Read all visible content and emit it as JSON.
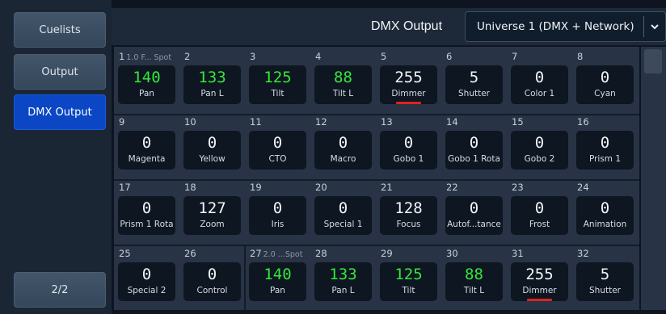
{
  "sidebar": {
    "cuelists": "Cuelists",
    "output": "Output",
    "dmx_output": "DMX Output",
    "page": "2/2"
  },
  "header": {
    "title": "DMX Output",
    "universe": "Universe 1 (DMX + Network)",
    "dropdown_icon": "chevron-down"
  },
  "colors": {
    "active": "#0b47c4",
    "changed_value": "#36e63b",
    "dimmer_marker": "#e0221f"
  },
  "channels": [
    {
      "ch": "1",
      "fixture": "1.0 F... Spot",
      "value": "140",
      "name": "Pan",
      "green": true
    },
    {
      "ch": "2",
      "value": "133",
      "name": "Pan L",
      "green": true
    },
    {
      "ch": "3",
      "value": "125",
      "name": "Tilt",
      "green": true
    },
    {
      "ch": "4",
      "value": "88",
      "name": "Tilt L",
      "green": true
    },
    {
      "ch": "5",
      "value": "255",
      "name": "Dimmer",
      "underline": true
    },
    {
      "ch": "6",
      "value": "5",
      "name": "Shutter"
    },
    {
      "ch": "7",
      "value": "0",
      "name": "Color 1"
    },
    {
      "ch": "8",
      "value": "0",
      "name": "Cyan"
    },
    {
      "ch": "9",
      "value": "0",
      "name": "Magenta"
    },
    {
      "ch": "10",
      "value": "0",
      "name": "Yellow"
    },
    {
      "ch": "11",
      "value": "0",
      "name": "CTO"
    },
    {
      "ch": "12",
      "value": "0",
      "name": "Macro"
    },
    {
      "ch": "13",
      "value": "0",
      "name": "Gobo 1"
    },
    {
      "ch": "14",
      "value": "0",
      "name": "Gobo 1 Rota"
    },
    {
      "ch": "15",
      "value": "0",
      "name": "Gobo 2"
    },
    {
      "ch": "16",
      "value": "0",
      "name": "Prism 1"
    },
    {
      "ch": "17",
      "value": "0",
      "name": "Prism 1 Rota"
    },
    {
      "ch": "18",
      "value": "127",
      "name": "Zoom"
    },
    {
      "ch": "19",
      "value": "0",
      "name": "Iris"
    },
    {
      "ch": "20",
      "value": "0",
      "name": "Special 1"
    },
    {
      "ch": "21",
      "value": "128",
      "name": "Focus"
    },
    {
      "ch": "22",
      "value": "0",
      "name": "Autof...tance"
    },
    {
      "ch": "23",
      "value": "0",
      "name": "Frost"
    },
    {
      "ch": "24",
      "value": "0",
      "name": "Animation"
    },
    {
      "ch": "25",
      "value": "0",
      "name": "Special 2"
    },
    {
      "ch": "26",
      "value": "0",
      "name": "Control"
    },
    {
      "ch": "27",
      "fixture": "2.0 ...Spot",
      "value": "140",
      "name": "Pan",
      "green": true
    },
    {
      "ch": "28",
      "value": "133",
      "name": "Pan L",
      "green": true
    },
    {
      "ch": "29",
      "value": "125",
      "name": "Tilt",
      "green": true
    },
    {
      "ch": "30",
      "value": "88",
      "name": "Tilt L",
      "green": true
    },
    {
      "ch": "31",
      "value": "255",
      "name": "Dimmer",
      "underline": true
    },
    {
      "ch": "32",
      "value": "5",
      "name": "Shutter"
    }
  ]
}
